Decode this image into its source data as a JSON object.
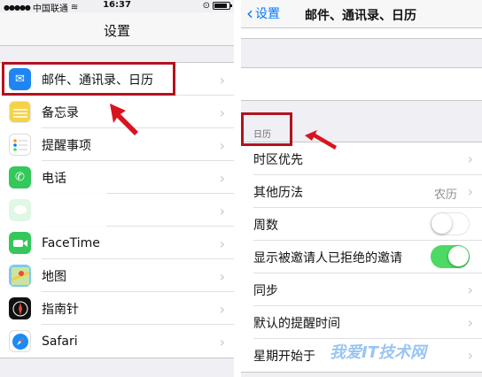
{
  "left": {
    "status": {
      "carrier": "中国联通",
      "time": "16:37"
    },
    "title": "设置",
    "items": [
      {
        "label": "邮件、通讯录、日历",
        "icon": "mail-icon",
        "color": "#1f86f1"
      },
      {
        "label": "备忘录",
        "icon": "notes-icon",
        "color": "#f6d247"
      },
      {
        "label": "提醒事项",
        "icon": "reminders-icon",
        "color": "#ffffff"
      },
      {
        "label": "电话",
        "icon": "phone-icon",
        "color": "#34c759"
      },
      {
        "label": "",
        "icon": "messages-icon",
        "color": "#34c759"
      },
      {
        "label": "FaceTime",
        "icon": "facetime-icon",
        "color": "#34c759"
      },
      {
        "label": "地图",
        "icon": "maps-icon",
        "color": "#7fc7f2"
      },
      {
        "label": "指南针",
        "icon": "compass-icon",
        "color": "#111111"
      },
      {
        "label": "Safari",
        "icon": "safari-icon",
        "color": "#1b8cf5"
      }
    ]
  },
  "right": {
    "back_label": "设置",
    "title": "邮件、通讯录、日历",
    "section_header": "日历",
    "rows": [
      {
        "label": "时区优先",
        "value": "",
        "control": "chevron"
      },
      {
        "label": "其他历法",
        "value": "农历",
        "control": "chevron"
      },
      {
        "label": "周数",
        "value": "",
        "control": "toggle-off"
      },
      {
        "label": "显示被邀请人已拒绝的邀请",
        "value": "",
        "control": "toggle-on"
      },
      {
        "label": "同步",
        "value": "",
        "control": "chevron"
      },
      {
        "label": "默认的提醒时间",
        "value": "",
        "control": "chevron"
      },
      {
        "label": "星期开始于",
        "value": "",
        "control": "chevron"
      }
    ]
  },
  "watermark": "我爱IT技术网",
  "colors": {
    "accent": "#007aff",
    "highlight": "#b3121e",
    "toggle_on": "#4cd964"
  }
}
